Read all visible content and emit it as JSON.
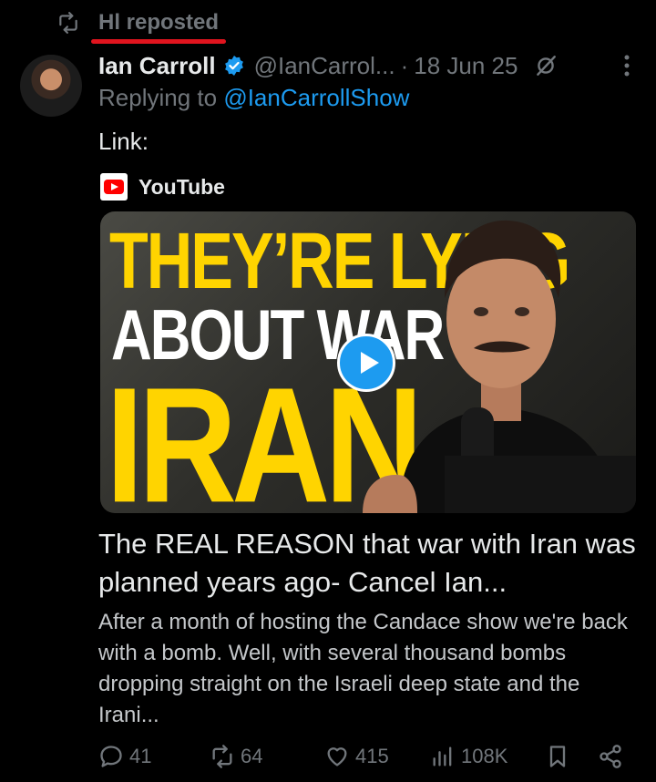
{
  "repost": {
    "label": "Hl reposted"
  },
  "tweet": {
    "name": "Ian Carroll",
    "handle": "@IanCarrol...",
    "dot": "·",
    "date": "18 Jun 25",
    "replying_prefix": "Replying to ",
    "replying_to": "@IanCarrollShow",
    "text": "Link:"
  },
  "card": {
    "source": "YouTube",
    "thumb_line1": "THEY’RE LYING",
    "thumb_line2": "ABOUT WAR IN",
    "thumb_line3": "IRAN",
    "title": "The REAL REASON that war with Iran was planned years ago- Cancel Ian...",
    "description": "After a month of hosting the Candace show we're back with a bomb. Well, with several thousand bombs dropping straight on the Israeli deep state and the Irani..."
  },
  "actions": {
    "replies": "41",
    "reposts": "64",
    "likes": "415",
    "views": "108K"
  },
  "colors": {
    "accent": "#1d9bf0",
    "background": "#000000",
    "muted": "#71767b",
    "highlight": "#e0141e",
    "thumb_yellow": "#ffd400"
  }
}
